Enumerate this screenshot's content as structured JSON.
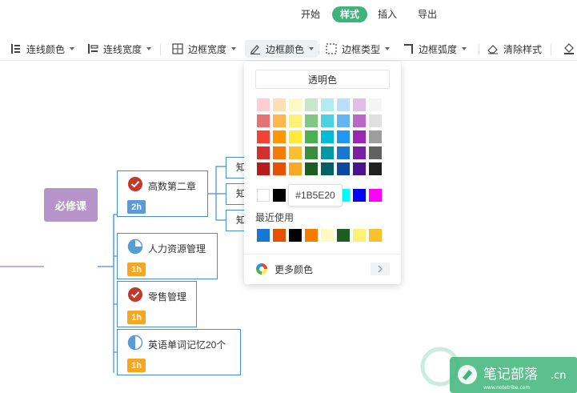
{
  "menu": {
    "tabs": [
      {
        "label": "开始",
        "active": false
      },
      {
        "label": "样式",
        "active": true
      },
      {
        "label": "插入",
        "active": false
      },
      {
        "label": "导出",
        "active": false
      }
    ]
  },
  "toolbar": {
    "items": [
      {
        "label": "连线颜色",
        "icon": "line-color-icon"
      },
      {
        "label": "连线宽度",
        "icon": "line-width-icon"
      },
      {
        "label": "边框宽度",
        "icon": "border-width-icon"
      },
      {
        "label": "边框颜色",
        "icon": "border-color-icon",
        "active": true
      },
      {
        "label": "边框类型",
        "icon": "border-type-icon"
      },
      {
        "label": "边框弧度",
        "icon": "border-radius-icon"
      },
      {
        "label": "清除样式",
        "icon": "eraser-icon"
      }
    ]
  },
  "mindmap": {
    "root": "必修课",
    "branches": [
      {
        "title": "高数第二章",
        "badge": "2h",
        "badge_color": "#5b9bd5",
        "icon": "check-circle-icon"
      },
      {
        "title": "人力资源管理",
        "badge": "1h",
        "badge_color": "#f5a623",
        "icon": "quarter-pie-icon"
      },
      {
        "title": "零售管理",
        "badge": "1h",
        "badge_color": "#f5a623",
        "icon": "check-circle-icon"
      },
      {
        "title": "英语单词记忆20个",
        "badge": "1h",
        "badge_color": "#f5a623",
        "icon": "half-pie-icon"
      }
    ],
    "side_nodes": [
      "知",
      "知",
      "知"
    ]
  },
  "color_picker": {
    "transparent_label": "透明色",
    "palette_rows": [
      [
        "#ffcdd2",
        "#ffe0b2",
        "#fff9c4",
        "#c8e6c9",
        "#b2ebf2",
        "#bbdefb",
        "#e1bee7",
        "#f5f5f5"
      ],
      [
        "#e57373",
        "#ffb74d",
        "#fff176",
        "#81c784",
        "#4dd0e1",
        "#64b5f6",
        "#ba68c8",
        "#e0e0e0"
      ],
      [
        "#f44336",
        "#ff9800",
        "#ffeb3b",
        "#4caf50",
        "#00bcd4",
        "#2196f3",
        "#9c27b0",
        "#9e9e9e"
      ],
      [
        "#d32f2f",
        "#f57c00",
        "#fbc02d",
        "#388e3c",
        "#0097a7",
        "#1976d2",
        "#7b1fa2",
        "#616161"
      ],
      [
        "#b71c1c",
        "#e65100",
        "#f9a825",
        "#1b5e20",
        "#006064",
        "#0d47a1",
        "#4a148c",
        "#212121"
      ]
    ],
    "basic_row": [
      "#ffffff",
      "#000000",
      "#ff0000",
      "#ffff00",
      "#00ff00",
      "#00ffff",
      "#0000ff",
      "#ff00ff"
    ],
    "tooltip_hex": "#1B5E20",
    "recent_label": "最近使用",
    "recent_colors": [
      "#1976d2",
      "#e65100",
      "#000000",
      "#f57c00",
      "#fff9c4",
      "#1b5e20",
      "#fff176",
      "#fbc02d"
    ],
    "more_colors_label": "更多颜色"
  },
  "colors": {
    "accent": "#3fb47a",
    "node_border": "#4a8ed1",
    "root_fill": "#b693c8",
    "connector_root": "#b693c8"
  }
}
